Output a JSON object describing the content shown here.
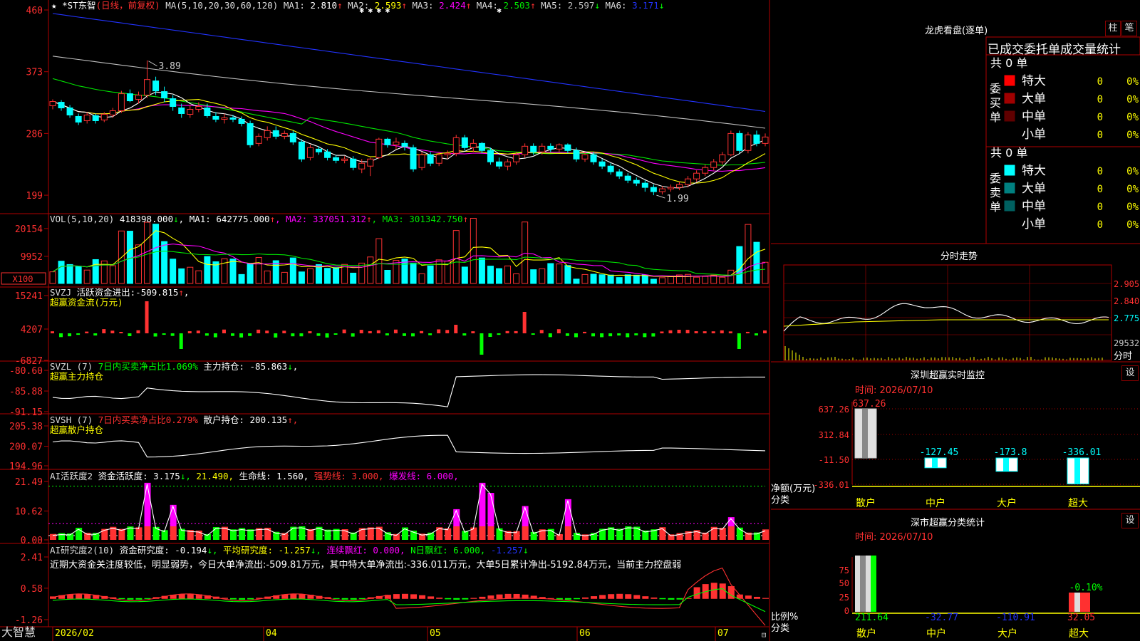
{
  "colors": {
    "up": "#ff3232",
    "down": "#00ffff",
    "grid": "#b00000",
    "ma1": "#ffffff",
    "ma2": "#ffff00",
    "ma3": "#ff00ff",
    "ma4": "#00e600",
    "ma5": "#bfbfbf",
    "ma6": "#2233ff",
    "green": "#00ff00",
    "yellow": "#ffff00"
  },
  "icons": [
    "star-icon",
    "lock-icon"
  ],
  "stock": {
    "star": "★",
    "name_prefix": "*ST东智",
    "mode": "(日线，前复权)",
    "ma_label": "MA(5,10,20,30,60,120)"
  },
  "ma_readouts": [
    {
      "k": "MA1:",
      "v": "2.810",
      "arr": "↑",
      "c": "#ffffff"
    },
    {
      "k": "MA2:",
      "v": "2.593",
      "arr": "↑",
      "c": "#ffff00"
    },
    {
      "k": "MA3:",
      "v": "2.424",
      "arr": "↑",
      "c": "#ff00ff"
    },
    {
      "k": "MA4:",
      "v": "2.503",
      "arr": "↑",
      "c": "#00e600"
    },
    {
      "k": "MA5:",
      "v": "2.597",
      "arr": "↓",
      "c": "#bfbfbf"
    },
    {
      "k": "MA6:",
      "v": "3.171",
      "arr": "↓",
      "c": "#2233ff"
    }
  ],
  "kline": {
    "y_ticks": [
      "460",
      "373",
      "286",
      "199"
    ],
    "y_tick_vals": [
      4.6,
      3.73,
      2.86,
      1.99
    ],
    "high_label": "3.89",
    "low_label": "1.99",
    "ylim": [
      1.75,
      4.6
    ],
    "candles": [
      [
        3.25,
        3.31,
        3.2,
        3.34
      ],
      [
        3.3,
        3.22,
        3.18,
        3.33
      ],
      [
        3.22,
        3.12,
        3.08,
        3.26
      ],
      [
        3.1,
        3.02,
        2.98,
        3.14
      ],
      [
        3.04,
        3.12,
        3.0,
        3.16
      ],
      [
        3.11,
        3.04,
        3.0,
        3.14
      ],
      [
        3.05,
        3.13,
        3.02,
        3.16
      ],
      [
        3.12,
        3.18,
        3.08,
        3.22
      ],
      [
        3.18,
        3.42,
        3.15,
        3.46
      ],
      [
        3.42,
        3.32,
        3.3,
        3.48
      ],
      [
        3.34,
        3.4,
        3.28,
        3.45
      ],
      [
        3.4,
        3.62,
        3.36,
        3.89
      ],
      [
        3.6,
        3.46,
        3.4,
        3.66
      ],
      [
        3.45,
        3.36,
        3.3,
        3.52
      ],
      [
        3.35,
        3.24,
        3.18,
        3.4
      ],
      [
        3.22,
        3.14,
        3.08,
        3.28
      ],
      [
        3.13,
        3.2,
        3.08,
        3.26
      ],
      [
        3.2,
        3.24,
        3.16,
        3.3
      ],
      [
        3.22,
        3.11,
        3.08,
        3.28
      ],
      [
        3.1,
        3.06,
        3.02,
        3.16
      ],
      [
        3.06,
        3.08,
        3.0,
        3.14
      ],
      [
        3.08,
        3.06,
        3.02,
        3.12
      ],
      [
        3.06,
        3.0,
        2.96,
        3.1
      ],
      [
        3.0,
        2.7,
        2.66,
        3.04
      ],
      [
        2.72,
        2.82,
        2.68,
        2.86
      ],
      [
        2.8,
        2.9,
        2.76,
        2.96
      ],
      [
        2.9,
        2.82,
        2.78,
        2.96
      ],
      [
        2.82,
        2.86,
        2.78,
        2.9
      ],
      [
        2.86,
        2.74,
        2.7,
        2.9
      ],
      [
        2.74,
        2.5,
        2.46,
        2.78
      ],
      [
        2.52,
        2.66,
        2.48,
        2.7
      ],
      [
        2.64,
        2.6,
        2.56,
        2.68
      ],
      [
        2.6,
        2.52,
        2.48,
        2.64
      ],
      [
        2.52,
        2.48,
        2.44,
        2.56
      ],
      [
        2.48,
        2.5,
        2.44,
        2.54
      ],
      [
        2.5,
        2.38,
        2.34,
        2.54
      ],
      [
        2.36,
        2.44,
        2.3,
        2.5
      ],
      [
        2.4,
        2.5,
        2.26,
        2.52
      ],
      [
        2.52,
        2.78,
        2.5,
        2.8
      ],
      [
        2.78,
        2.7,
        2.66,
        2.8
      ],
      [
        2.7,
        2.74,
        2.64,
        2.8
      ],
      [
        2.72,
        2.68,
        2.62,
        2.76
      ],
      [
        2.66,
        2.36,
        2.32,
        2.7
      ],
      [
        2.38,
        2.56,
        2.34,
        2.6
      ],
      [
        2.56,
        2.44,
        2.4,
        2.6
      ],
      [
        2.44,
        2.56,
        2.4,
        2.6
      ],
      [
        2.56,
        2.58,
        2.5,
        2.62
      ],
      [
        2.58,
        2.8,
        2.54,
        2.84
      ],
      [
        2.8,
        2.66,
        2.62,
        2.84
      ],
      [
        2.66,
        2.72,
        2.6,
        2.78
      ],
      [
        2.72,
        2.62,
        2.58,
        2.74
      ],
      [
        2.62,
        2.46,
        2.42,
        2.66
      ],
      [
        2.46,
        2.4,
        2.36,
        2.52
      ],
      [
        2.4,
        2.46,
        2.34,
        2.5
      ],
      [
        2.46,
        2.56,
        2.42,
        2.6
      ],
      [
        2.56,
        2.68,
        2.52,
        2.72
      ],
      [
        2.68,
        2.6,
        2.56,
        2.72
      ],
      [
        2.6,
        2.68,
        2.56,
        2.72
      ],
      [
        2.68,
        2.64,
        2.6,
        2.72
      ],
      [
        2.64,
        2.7,
        2.6,
        2.72
      ],
      [
        2.7,
        2.62,
        2.58,
        2.72
      ],
      [
        2.62,
        2.5,
        2.46,
        2.66
      ],
      [
        2.5,
        2.56,
        2.46,
        2.6
      ],
      [
        2.56,
        2.46,
        2.42,
        2.6
      ],
      [
        2.46,
        2.4,
        2.36,
        2.5
      ],
      [
        2.4,
        2.32,
        2.28,
        2.44
      ],
      [
        2.32,
        2.26,
        2.22,
        2.36
      ],
      [
        2.26,
        2.2,
        2.16,
        2.3
      ],
      [
        2.2,
        2.16,
        2.12,
        2.24
      ],
      [
        2.16,
        2.1,
        2.04,
        2.2
      ],
      [
        2.1,
        2.04,
        1.99,
        2.14
      ],
      [
        2.04,
        2.08,
        2.0,
        2.12
      ],
      [
        2.08,
        2.1,
        2.04,
        2.14
      ],
      [
        2.1,
        2.14,
        2.06,
        2.18
      ],
      [
        2.14,
        2.22,
        2.1,
        2.26
      ],
      [
        2.22,
        2.3,
        2.18,
        2.34
      ],
      [
        2.3,
        2.38,
        2.26,
        2.42
      ],
      [
        2.38,
        2.46,
        2.34,
        2.5
      ],
      [
        2.46,
        2.56,
        2.42,
        2.6
      ],
      [
        2.56,
        2.86,
        2.54,
        2.9
      ],
      [
        2.86,
        2.62,
        2.58,
        2.9
      ],
      [
        2.62,
        2.84,
        2.58,
        2.88
      ],
      [
        2.84,
        2.72,
        2.68,
        2.9
      ],
      [
        2.72,
        2.81,
        2.68,
        2.86
      ]
    ]
  },
  "vol": {
    "label": "VOL(5,10,20)",
    "v": "418398.000",
    "arr": "↓",
    "ma": [
      {
        "k": "MA1:",
        "v": "642775.000",
        "arr": "↑",
        "c": "#ffffff"
      },
      {
        "k": "MA2:",
        "v": "337051.312",
        "arr": "↑",
        "c": "#ff00ff"
      },
      {
        "k": "MA3:",
        "v": "301342.750",
        "arr": "↑",
        "c": "#00e600"
      }
    ],
    "y_ticks": [
      "20154",
      "9952"
    ],
    "y_tick_vals": [
      20154,
      9952
    ],
    "unit": "X100",
    "ylim": [
      0,
      23000
    ]
  },
  "svzj": {
    "label": "SVZJ",
    "k": "活跃资金进出:",
    "v": "-509.815",
    "arr": "↑",
    "sub": "超赢资金流(万元)",
    "y_ticks": [
      "15241",
      "4207",
      "-6827"
    ],
    "y_tick_vals": [
      15241,
      4207,
      -6827
    ]
  },
  "svzl": {
    "label": "SVZL",
    "n": "(7)",
    "desc": "7日内买卖净占比1.069%",
    "k": "主力持仓:",
    "v": "-85.863",
    "arr": "↓",
    "sub": "超赢主力持仓",
    "y_ticks": [
      "-80.60",
      "-85.88",
      "-91.15"
    ],
    "y_tick_vals": [
      -80.6,
      -85.88,
      -91.15
    ]
  },
  "svsh": {
    "label": "SVSH",
    "n": "(7)",
    "desc": "7日内买卖净占比0.279%",
    "k": "散户持仓:",
    "v": "200.135",
    "arr": "↑",
    "sub": "超赢散户持仓",
    "y_ticks": [
      "205.38",
      "200.07",
      "194.96"
    ],
    "y_tick_vals": [
      205.38,
      200.07,
      194.96
    ]
  },
  "ai2": {
    "label": "AI活跃度2",
    "k1": "资金活跃度:",
    "v1": "3.175",
    "a1": "↓",
    "v2": "21.490",
    "k3": "生命线:",
    "v3": "1.560",
    "k4": "强势线:",
    "v4": "3.000",
    "k5": "爆发线:",
    "v5": "6.000",
    "y_ticks": [
      "21.49",
      "10.62",
      "0.00"
    ],
    "y_tick_vals": [
      21.49,
      10.62,
      0.0
    ]
  },
  "ai_research": {
    "label": "AI研究度2(10)",
    "k1": "资金研究度:",
    "v1": "-0.194",
    "a1": "↓",
    "k2": "平均研究度:",
    "v2": "-1.257",
    "a2": "↓",
    "k3": "连续飘红:",
    "v3": "0.000",
    "k4": "N日飘红:",
    "v4": "6.000",
    "v5": "-1.257",
    "a5": "↓",
    "note": "近期大资金关注度较低，明显弱势，今日大单净流出:-509.81万元，其中特大单净流出:-336.011万元，大单5日累计净出-5192.84万元，当前主力控盘弱",
    "y_ticks": [
      "2.41",
      "0.58",
      "-1.26"
    ],
    "y_tick_vals": [
      2.41,
      0.58,
      -1.26
    ]
  },
  "x_axis": {
    "labels": [
      "2026/02",
      "04",
      "05",
      "06",
      "07"
    ],
    "brand": "大智慧"
  },
  "lhb": {
    "title": "龙虎看盘(逐单)",
    "btn1": "柱",
    "btn2": "笔",
    "tab": "已成交委托单成交量统计",
    "buy": {
      "side": "委买单",
      "total": "共 0 单",
      "rows": [
        {
          "name": "特大",
          "v": "0",
          "p": "0%",
          "c": "#ff0000"
        },
        {
          "name": "大单",
          "v": "0",
          "p": "0%",
          "c": "#a00000"
        },
        {
          "name": "中单",
          "v": "0",
          "p": "0%",
          "c": "#600000"
        },
        {
          "name": "小单",
          "v": "0",
          "p": "0%",
          "c": "#000000"
        }
      ]
    },
    "sell": {
      "side": "委卖单",
      "total": "共 0 单",
      "rows": [
        {
          "name": "特大",
          "v": "0",
          "p": "0%",
          "c": "#00ffff"
        },
        {
          "name": "大单",
          "v": "0",
          "p": "0%",
          "c": "#008080"
        },
        {
          "name": "中单",
          "v": "0",
          "p": "0%",
          "c": "#006060"
        },
        {
          "name": "小单",
          "v": "0",
          "p": "0%",
          "c": "#000000"
        }
      ]
    }
  },
  "fenshi": {
    "title": "分时走势",
    "y_ticks": [
      "2.905",
      "2.840",
      "2.775",
      "29532"
    ],
    "corner": "分时"
  },
  "monitor": {
    "title": "深圳超赢实时监控",
    "btn": "设",
    "time": "时间: 2026/07/10",
    "y_ticks": [
      "637.26",
      "312.84",
      "-11.50",
      "-336.01"
    ],
    "unit": "净额(万元)",
    "cat_label": "分类"
  },
  "stats": {
    "title": "深市超赢分类统计",
    "btn": "设",
    "time": "时间: 2026/07/10",
    "y_ticks": [
      "75",
      "50",
      "25",
      "0"
    ],
    "unit": "比例%",
    "cat_label": "分类"
  },
  "chart_data": [
    {
      "type": "bar",
      "title": "深圳超赢实时监控",
      "categories": [
        "散户",
        "中户",
        "大户",
        "超大"
      ],
      "values": [
        637.26,
        -127.45,
        -173.8,
        -336.01
      ],
      "ylabel": "净额(万元)",
      "ylim": [
        -336.01,
        637.26
      ]
    },
    {
      "type": "bar",
      "title": "深市超赢分类统计",
      "categories": [
        "散户",
        "中户",
        "大户",
        "超大"
      ],
      "values": [
        211.64,
        -32.77,
        -110.91,
        32.05
      ],
      "annotation": "-0.10%",
      "ylabel": "比例%",
      "ylim": [
        0,
        100
      ]
    }
  ]
}
